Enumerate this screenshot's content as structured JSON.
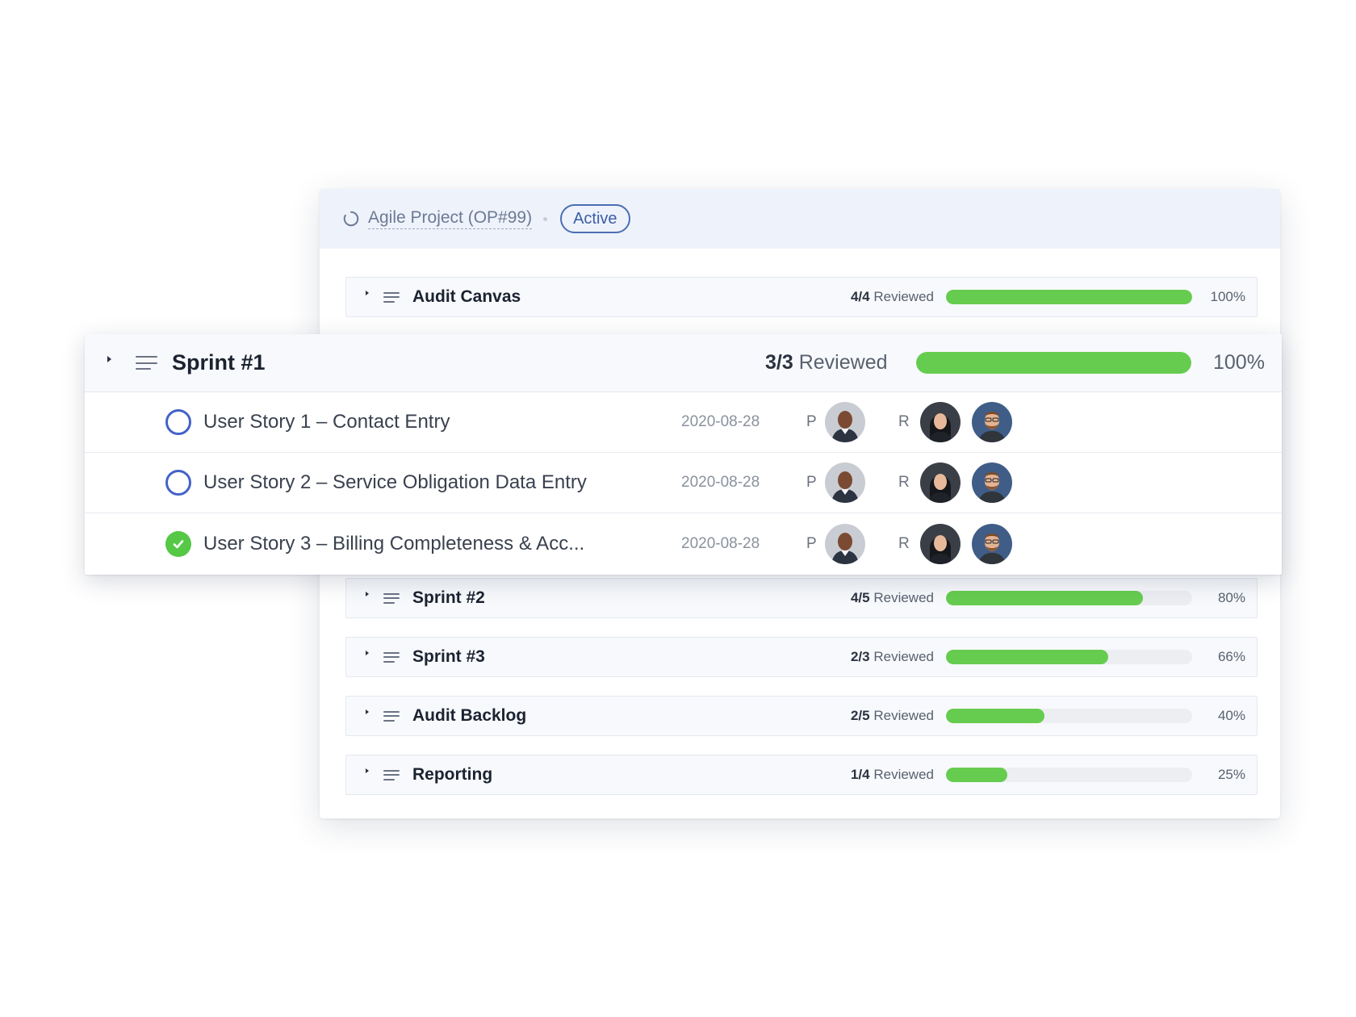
{
  "header": {
    "project_title": "Agile Project (OP#99)",
    "status_badge": "Active",
    "icons": [
      "spinner-icon"
    ]
  },
  "groups": [
    {
      "name": "Audit Canvas",
      "reviewed_count": "4/4",
      "reviewed_label": "Reviewed",
      "progress": 100,
      "percent_label": "100%"
    },
    {
      "name": "Sprint #2",
      "reviewed_count": "4/5",
      "reviewed_label": "Reviewed",
      "progress": 80,
      "percent_label": "80%"
    },
    {
      "name": "Sprint #3",
      "reviewed_count": "2/3",
      "reviewed_label": "Reviewed",
      "progress": 66,
      "percent_label": "66%"
    },
    {
      "name": "Audit Backlog",
      "reviewed_count": "2/5",
      "reviewed_label": "Reviewed",
      "progress": 40,
      "percent_label": "40%"
    },
    {
      "name": "Reporting",
      "reviewed_count": "1/4",
      "reviewed_label": "Reviewed",
      "progress": 25,
      "percent_label": "25%"
    }
  ],
  "sprint1": {
    "title": "Sprint #1",
    "reviewed_count": "3/3",
    "reviewed_label": "Reviewed",
    "progress": 100,
    "percent_label": "100%",
    "stories": [
      {
        "title": "User Story 1 – Contact Entry",
        "status": "open",
        "date": "2020-08-28",
        "preparer_label": "P",
        "reviewer_label": "R"
      },
      {
        "title": "User Story 2 – Service Obligation Data Entry",
        "status": "open",
        "date": "2020-08-28",
        "preparer_label": "P",
        "reviewer_label": "R"
      },
      {
        "title": "User Story 3 – Billing Completeness & Acc...",
        "status": "done",
        "date": "2020-08-28",
        "preparer_label": "P",
        "reviewer_label": "R"
      }
    ]
  },
  "colors": {
    "progress_green": "#66cc4f",
    "badge_blue": "#3a5ea6",
    "open_circle": "#4462c8",
    "done_circle": "#55c846",
    "header_bg": "#eef2fb"
  }
}
